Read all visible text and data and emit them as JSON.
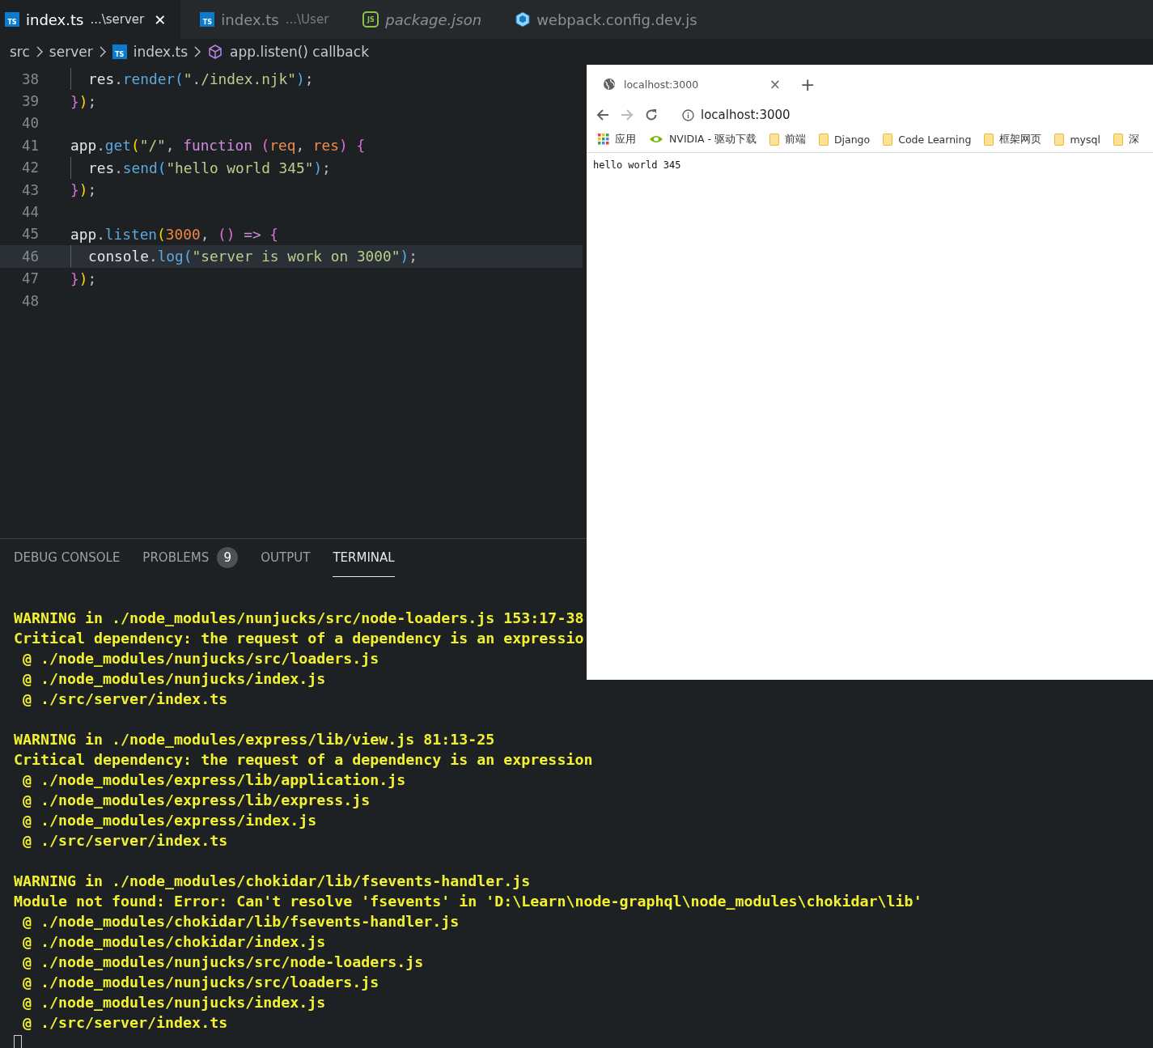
{
  "editor_tabs": [
    {
      "label": "index.ts",
      "detail": "...\\server",
      "kind": "ts",
      "icon_text": "TS",
      "selected": true,
      "italic": false,
      "close": "✕"
    },
    {
      "label": "index.ts",
      "detail": "...\\User",
      "kind": "ts",
      "icon_text": "TS",
      "selected": false,
      "italic": false
    },
    {
      "label": "package.json",
      "kind": "js",
      "icon_text": "JS",
      "selected": false,
      "italic": true
    },
    {
      "label": "webpack.config.dev.js",
      "kind": "cube",
      "selected": false,
      "italic": false
    }
  ],
  "breadcrumb": [
    {
      "label": "src",
      "kind": "folder"
    },
    {
      "label": "server",
      "kind": "folder"
    },
    {
      "label": "index.ts",
      "kind": "ts",
      "icon_text": "TS"
    },
    {
      "label": "app.listen() callback",
      "kind": "symbol"
    }
  ],
  "code_lines": [
    {
      "number": "38",
      "indent": true,
      "current": false,
      "tokens": [
        {
          "text": "res",
          "kind": "var"
        },
        {
          "text": ".",
          "kind": "punct"
        },
        {
          "text": "render",
          "kind": "method"
        },
        {
          "text": "(",
          "kind": "b3"
        },
        {
          "text": "\"./index.njk\"",
          "kind": "string"
        },
        {
          "text": ")",
          "kind": "b3"
        },
        {
          "text": ";",
          "kind": "punct"
        }
      ]
    },
    {
      "number": "39",
      "indent": false,
      "current": false,
      "tokens": [
        {
          "text": "}",
          "kind": "b1"
        },
        {
          "text": ")",
          "kind": "b2"
        },
        {
          "text": ";",
          "kind": "punct"
        }
      ]
    },
    {
      "number": "40",
      "current": false
    },
    {
      "number": "41",
      "indent": false,
      "current": false,
      "tokens": [
        {
          "text": "app",
          "kind": "var"
        },
        {
          "text": ".",
          "kind": "punct"
        },
        {
          "text": "get",
          "kind": "method"
        },
        {
          "text": "(",
          "kind": "b2"
        },
        {
          "text": "\"/\"",
          "kind": "string"
        },
        {
          "text": ", ",
          "kind": "punct"
        },
        {
          "text": "function",
          "kind": "keyword"
        },
        {
          "text": " (",
          "kind": "b1"
        },
        {
          "text": "req",
          "kind": "param"
        },
        {
          "text": ", ",
          "kind": "punct"
        },
        {
          "text": "res",
          "kind": "param"
        },
        {
          "text": ")",
          "kind": "b1"
        },
        {
          "text": " {",
          "kind": "b1"
        }
      ]
    },
    {
      "number": "42",
      "indent": true,
      "current": false,
      "tokens": [
        {
          "text": "res",
          "kind": "var"
        },
        {
          "text": ".",
          "kind": "punct"
        },
        {
          "text": "send",
          "kind": "method"
        },
        {
          "text": "(",
          "kind": "b3"
        },
        {
          "text": "\"hello world 345\"",
          "kind": "string"
        },
        {
          "text": ")",
          "kind": "b3"
        },
        {
          "text": ";",
          "kind": "punct"
        }
      ]
    },
    {
      "number": "43",
      "indent": false,
      "current": false,
      "tokens": [
        {
          "text": "}",
          "kind": "b1"
        },
        {
          "text": ")",
          "kind": "b2"
        },
        {
          "text": ";",
          "kind": "punct"
        }
      ]
    },
    {
      "number": "44",
      "current": false
    },
    {
      "number": "45",
      "indent": false,
      "current": false,
      "tokens": [
        {
          "text": "app",
          "kind": "var"
        },
        {
          "text": ".",
          "kind": "punct"
        },
        {
          "text": "listen",
          "kind": "method"
        },
        {
          "text": "(",
          "kind": "b2"
        },
        {
          "text": "3000",
          "kind": "number"
        },
        {
          "text": ", ",
          "kind": "punct"
        },
        {
          "text": "()",
          "kind": "b1"
        },
        {
          "text": " => ",
          "kind": "keyword"
        },
        {
          "text": "{",
          "kind": "b1"
        }
      ]
    },
    {
      "number": "46",
      "indent": true,
      "current": true,
      "tokens": [
        {
          "text": "console",
          "kind": "var"
        },
        {
          "text": ".",
          "kind": "punct"
        },
        {
          "text": "log",
          "kind": "method"
        },
        {
          "text": "(",
          "kind": "b3"
        },
        {
          "text": "\"server is work on 3000\"",
          "kind": "string"
        },
        {
          "text": ")",
          "kind": "b3"
        },
        {
          "text": ";",
          "kind": "punct"
        }
      ]
    },
    {
      "number": "47",
      "indent": false,
      "current": false,
      "tokens": [
        {
          "text": "}",
          "kind": "b1"
        },
        {
          "text": ")",
          "kind": "b2"
        },
        {
          "text": ";",
          "kind": "punct"
        }
      ]
    },
    {
      "number": "48",
      "current": false
    }
  ],
  "panel_tabs": [
    {
      "label": "DEBUG CONSOLE",
      "selected": false
    },
    {
      "label": "PROBLEMS",
      "badge": "9",
      "selected": false
    },
    {
      "label": "OUTPUT",
      "selected": false
    },
    {
      "label": "TERMINAL",
      "selected": true
    }
  ],
  "terminal_blocks": [
    {
      "lines": [
        "WARNING in ./node_modules/nunjucks/src/node-loaders.js 153:17-38",
        "Critical dependency: the request of a dependency is an expressio",
        " @ ./node_modules/nunjucks/src/loaders.js",
        " @ ./node_modules/nunjucks/index.js",
        " @ ./src/server/index.ts"
      ]
    },
    {
      "lines": [
        "WARNING in ./node_modules/express/lib/view.js 81:13-25",
        "Critical dependency: the request of a dependency is an expression",
        " @ ./node_modules/express/lib/application.js",
        " @ ./node_modules/express/lib/express.js",
        " @ ./node_modules/express/index.js",
        " @ ./src/server/index.ts"
      ]
    },
    {
      "lines": [
        "WARNING in ./node_modules/chokidar/lib/fsevents-handler.js",
        "Module not found: Error: Can't resolve 'fsevents' in 'D:\\Learn\\node-graphql\\node_modules\\chokidar\\lib'",
        " @ ./node_modules/chokidar/lib/fsevents-handler.js",
        " @ ./node_modules/chokidar/index.js",
        " @ ./node_modules/nunjucks/src/node-loaders.js",
        " @ ./node_modules/nunjucks/src/loaders.js",
        " @ ./node_modules/nunjucks/index.js",
        " @ ./src/server/index.ts"
      ]
    }
  ],
  "browser": {
    "tab_title": "localhost:3000",
    "tab_close": "×",
    "new_tab": "+",
    "address": "localhost:3000",
    "bookmarks": [
      {
        "label": "应用",
        "kind": "apps"
      },
      {
        "label": "NVIDIA - 驱动下载",
        "kind": "vendor"
      },
      {
        "label": "前端",
        "kind": "folder"
      },
      {
        "label": "Django",
        "kind": "folder"
      },
      {
        "label": "Code Learning",
        "kind": "folder"
      },
      {
        "label": "框架网页",
        "kind": "folder"
      },
      {
        "label": "mysql",
        "kind": "folder"
      },
      {
        "label": "深",
        "kind": "folder"
      }
    ],
    "page_text": "hello world 345"
  }
}
